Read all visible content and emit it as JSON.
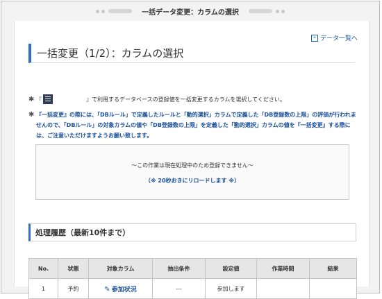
{
  "window": {
    "title": "一括データ変更：カラムの選択"
  },
  "nav": {
    "list_link_label": "データ一覧へ"
  },
  "page": {
    "heading": "一括変更（1/2）：カラムの選択"
  },
  "notes": {
    "note1_prefix": "『",
    "note1_text": "』で利用するデータベースの登録値を一括変更するカラムを選択してください。",
    "note2_text": "『一括変更』の際には、「DBルール」で定義したルールと「動的選択」カラムで定義した「DB登録数の上限」の評価が行われませんので、「DBルール」の対象カラムの値や「DB登録数の上限」を定義した「動的選択」カラムの値を『一括変更』する際には、ご注意いただけますようお願い致します。"
  },
  "status_box": {
    "message": "～この作業は現在処理中のため登録できません～",
    "reload_note": "（※ 20秒おきにリロードします ※）"
  },
  "history": {
    "title": "処理履歴（最新10件まで）",
    "columns": [
      "No.",
      "状態",
      "対象カラム",
      "抽出条件",
      "設定値",
      "作業時間",
      "結果"
    ],
    "rows": [
      {
        "no": "1",
        "status": "予約",
        "target": "参加状況",
        "condition": "---",
        "value": "参加します",
        "time": "",
        "result": ""
      }
    ]
  },
  "icons": {
    "list_link": "double-chevron-right-icon",
    "bullet": "asterisk-icon",
    "db": "database-icon",
    "edit": "pencil-icon"
  },
  "colors": {
    "accent": "#2d6fc2",
    "link": "#1a4f9a",
    "header_bg": "#e6e6e6"
  }
}
